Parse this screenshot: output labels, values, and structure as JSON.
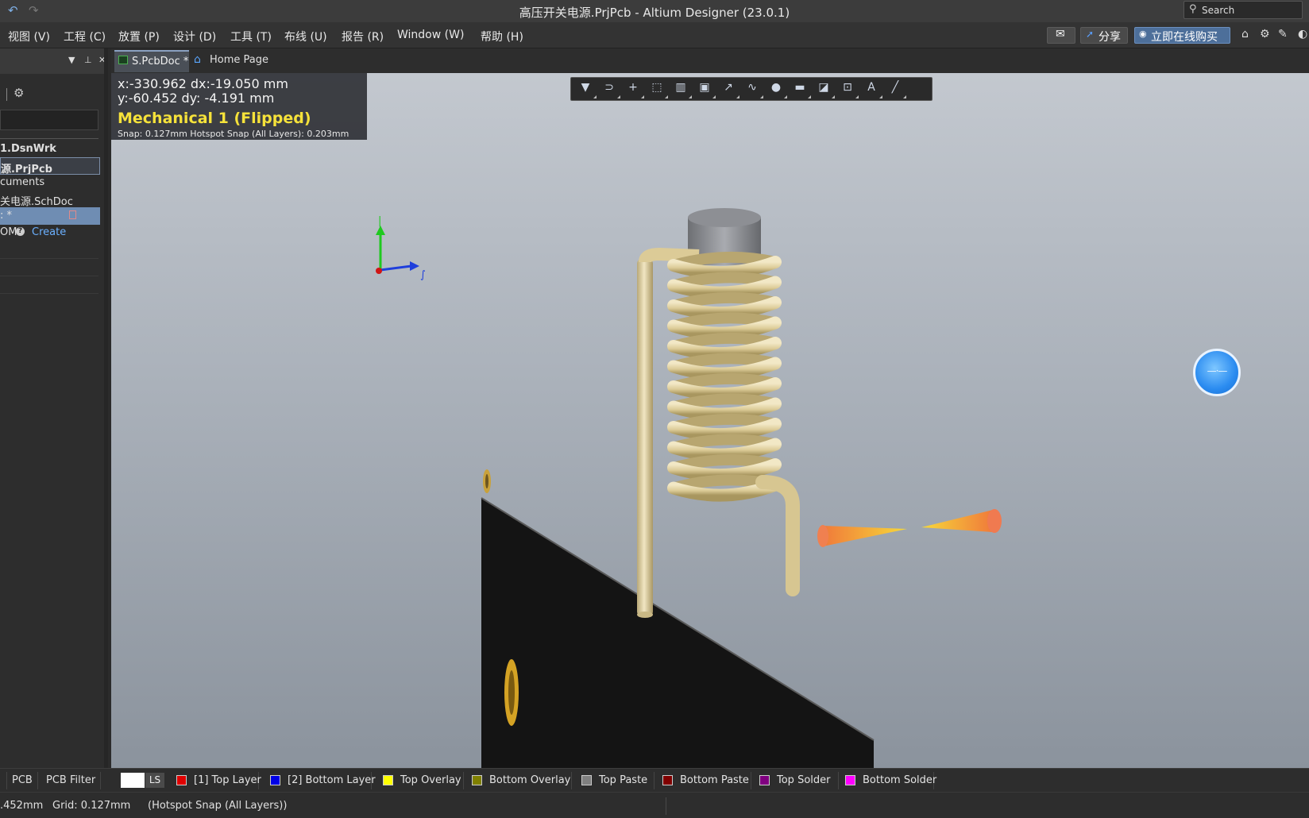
{
  "window": {
    "title": "高压开关电源.PrjPcb - Altium Designer (23.0.1)",
    "search_placeholder": "Search"
  },
  "menu": {
    "items": [
      "视图 (V)",
      "工程 (C)",
      "放置 (P)",
      "设计 (D)",
      "工具 (T)",
      "布线 (U)",
      "报告 (R)",
      "Window (W)",
      "帮助 (H)"
    ],
    "share_label": "分享",
    "buy_label": "立即在线购买"
  },
  "project_panel": {
    "tree": [
      {
        "label": "1.DsnWrk",
        "state": "bold"
      },
      {
        "label": "源.PrjPcb",
        "state": "selected-outline"
      },
      {
        "label": "cuments",
        "state": "normal"
      },
      {
        "label": "关电源.SchDoc",
        "state": "normal"
      },
      {
        "label": ": *",
        "state": "selected"
      },
      {
        "label": "OM",
        "state": "normal",
        "link": "Create"
      }
    ]
  },
  "tabs": {
    "pcb_doc": "S.PcbDoc *",
    "home": "Home Page"
  },
  "hud": {
    "line1": "x:-330.962   dx:-19.050 mm",
    "line2": "y:-60.452    dy: -4.191  mm",
    "layer": "Mechanical 1 (Flipped)",
    "snap": "Snap: 0.127mm Hotspot Snap (All Layers): 0.203mm"
  },
  "active_bar": {
    "buttons": [
      "filter-icon",
      "route-icon",
      "cross-icon",
      "select-rect-icon",
      "align-icon",
      "component-icon",
      "interactive-route-icon",
      "length-tune-icon",
      "pad-icon",
      "polygon-icon",
      "keepout-icon",
      "dimension-icon",
      "text-icon",
      "line-icon"
    ]
  },
  "layer_bar": {
    "panel_tabs": [
      "PCB",
      "PCB Filter"
    ],
    "ls_label": "LS",
    "layers": [
      {
        "label": "[1] Top Layer",
        "color": "#e00000"
      },
      {
        "label": "[2] Bottom Layer",
        "color": "#0000e6"
      },
      {
        "label": "Top Overlay",
        "color": "#ffff00"
      },
      {
        "label": "Bottom Overlay",
        "color": "#808000"
      },
      {
        "label": "Top Paste",
        "color": "#808080"
      },
      {
        "label": "Bottom Paste",
        "color": "#800000"
      },
      {
        "label": "Top Solder",
        "color": "#800080"
      },
      {
        "label": "Bottom Solder",
        "color": "#ff00ff"
      }
    ]
  },
  "status": {
    "coord": ".452mm",
    "grid": "Grid: 0.127mm",
    "snap_mode": "(Hotspot Snap (All Layers))"
  },
  "colors": {
    "accent": "#4d6f9a",
    "hud_layer": "#f6e23a",
    "board": "#141414",
    "coil": "#e2d3a3"
  }
}
